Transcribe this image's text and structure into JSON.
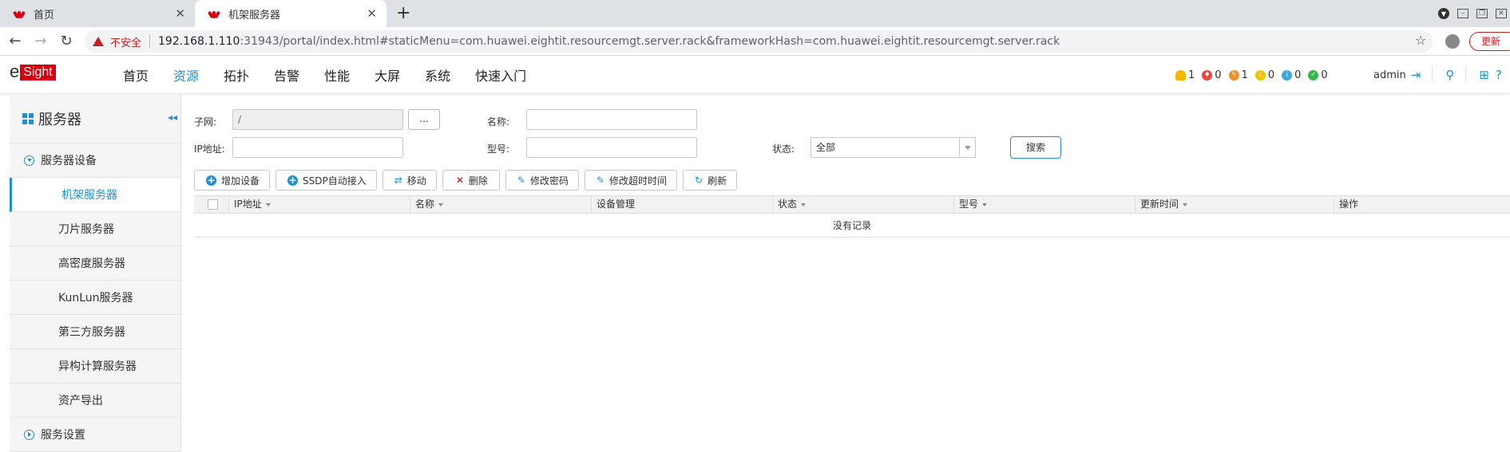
{
  "browser": {
    "tabs": [
      {
        "title": "首页"
      },
      {
        "title": "机架服务器"
      }
    ],
    "address": {
      "security_label": "不安全",
      "url_host": "192.168.1.110",
      "url_rest": ":31943/portal/index.html#staticMenu=com.huawei.eightit.resourcemgt.server.rack&frameworkHash=com.huawei.eightit.resourcemgt.server.rack"
    },
    "update_label": "更新"
  },
  "header": {
    "logo_e": "e",
    "logo_sight": "Sight",
    "menu": [
      "首页",
      "资源",
      "拓扑",
      "告警",
      "性能",
      "大屏",
      "系统",
      "快速入门"
    ],
    "active_menu": "资源",
    "alarms": [
      {
        "icon": "bell-icon",
        "count": "1",
        "color": "#f5b800"
      },
      {
        "icon": "critical-alarm-icon",
        "count": "0",
        "color": "#e8453c"
      },
      {
        "icon": "major-alarm-icon",
        "count": "1",
        "color": "#f08c2a"
      },
      {
        "icon": "minor-alarm-icon",
        "count": "0",
        "color": "#f5c400"
      },
      {
        "icon": "warning-alarm-icon",
        "count": "0",
        "color": "#3fa7e0"
      },
      {
        "icon": "cleared-alarm-icon",
        "count": "0",
        "color": "#3ab54a"
      }
    ],
    "user": "admin"
  },
  "sidebar": {
    "title": "服务器",
    "group1": "服务器设备",
    "items": [
      "机架服务器",
      "刀片服务器",
      "高密度服务器",
      "KunLun服务器",
      "第三方服务器",
      "异构计算服务器",
      "资产导出"
    ],
    "active_item": "机架服务器",
    "group2": "服务设置"
  },
  "filters": {
    "subnet_label": "子网:",
    "subnet_value": "/",
    "subnet_btn": "...",
    "name_label": "名称:",
    "ip_label": "IP地址:",
    "model_label": "型号:",
    "status_label": "状态:",
    "status_value": "全部",
    "search_btn": "搜索"
  },
  "toolbar": {
    "add": "增加设备",
    "ssdp": "SSDP自动接入",
    "move": "移动",
    "delete": "删除",
    "change_password": "修改密码",
    "change_timeout": "修改超时时间",
    "refresh": "刷新"
  },
  "table": {
    "columns": [
      "IP地址",
      "名称",
      "设备管理",
      "状态",
      "型号",
      "更新时间",
      "操作"
    ],
    "empty_text": "没有记录"
  }
}
